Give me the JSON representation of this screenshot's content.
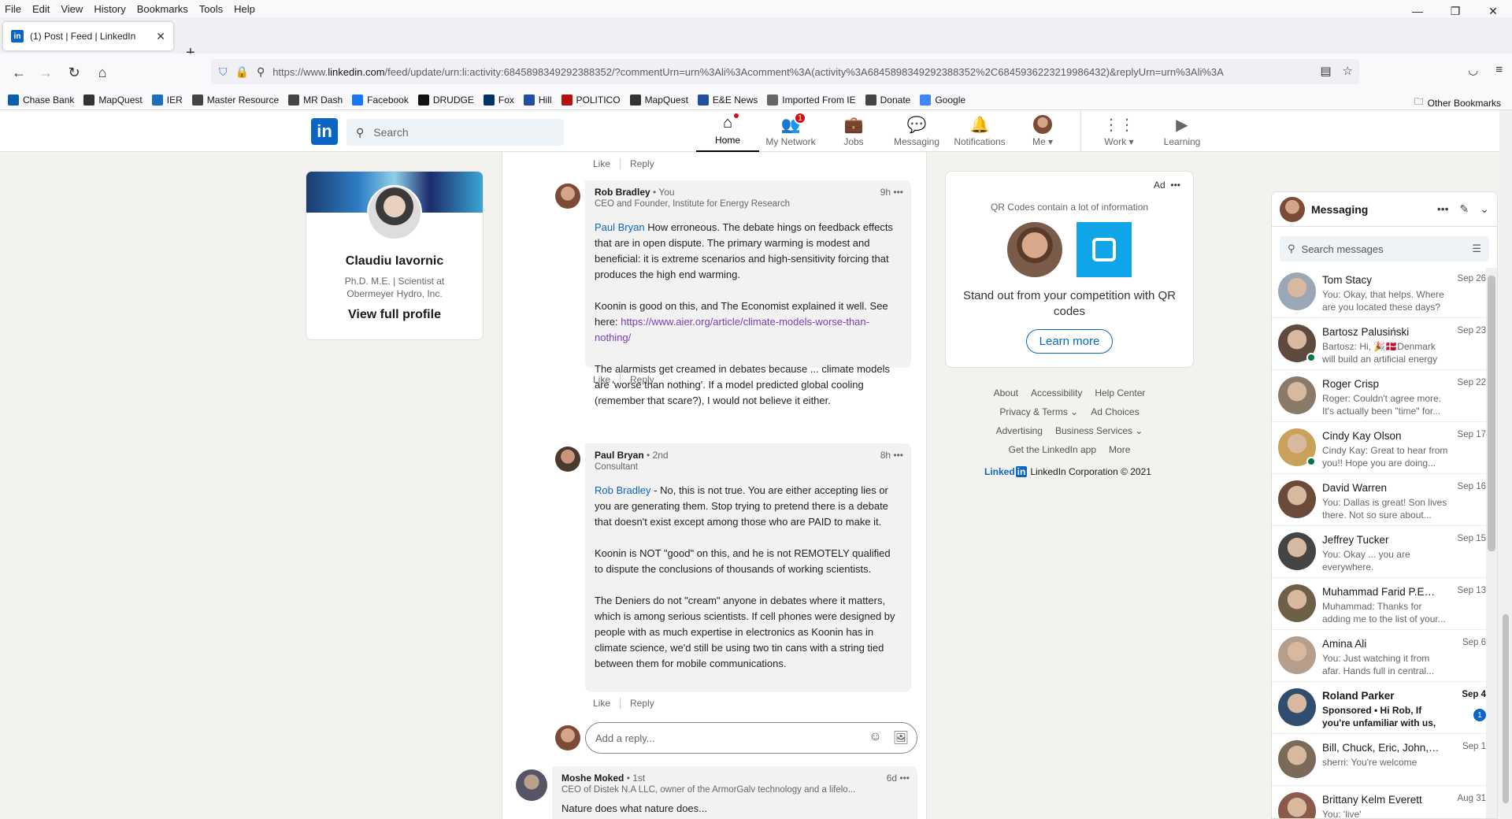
{
  "browser": {
    "menu": [
      "File",
      "Edit",
      "View",
      "History",
      "Bookmarks",
      "Tools",
      "Help"
    ],
    "tab_title": "(1) Post | Feed | LinkedIn",
    "url_prefix": "https://www.",
    "url_domain": "linkedin.com",
    "url_rest": "/feed/update/urn:li:activity:6845898349292388352/?commentUrn=urn%3Ali%3Acomment%3A(activity%3A6845898349292388352%2C6845936223219986432)&replyUrn=urn%3Ali%3A",
    "bookmarks": [
      {
        "label": "Chase Bank",
        "icon": "chase-icon",
        "color": "#0b5ea8"
      },
      {
        "label": "MapQuest",
        "icon": "mapquest-icon",
        "color": "#333"
      },
      {
        "label": "IER",
        "icon": "ier-icon",
        "color": "#1f6fbf"
      },
      {
        "label": "Master Resource",
        "icon": "mr-icon",
        "color": "#444"
      },
      {
        "label": "MR Dash",
        "icon": "mr-icon",
        "color": "#444"
      },
      {
        "label": "Facebook",
        "icon": "facebook-icon",
        "color": "#1877f2"
      },
      {
        "label": "DRUDGE",
        "icon": "drudge-icon",
        "color": "#111"
      },
      {
        "label": "Fox",
        "icon": "fox-icon",
        "color": "#003366"
      },
      {
        "label": "Hill",
        "icon": "hill-icon",
        "color": "#1f4f9e"
      },
      {
        "label": "POLITICO",
        "icon": "politico-icon",
        "color": "#b3120d"
      },
      {
        "label": "MapQuest",
        "icon": "mapquest-icon",
        "color": "#333"
      },
      {
        "label": "E&E News",
        "icon": "ee-icon",
        "color": "#1f4f9e"
      },
      {
        "label": "Imported From IE",
        "icon": "folder-icon",
        "color": "#666"
      },
      {
        "label": "Donate",
        "icon": "globe-icon",
        "color": "#444"
      },
      {
        "label": "Google",
        "icon": "google-icon",
        "color": "#4285f4"
      }
    ],
    "other_bookmarks": "Other Bookmarks"
  },
  "linkedin": {
    "search_placeholder": "Search",
    "nav": [
      {
        "label": "Home",
        "icon": "home-icon"
      },
      {
        "label": "My Network",
        "icon": "network-icon",
        "badge": "1"
      },
      {
        "label": "Jobs",
        "icon": "jobs-icon"
      },
      {
        "label": "Messaging",
        "icon": "messaging-icon"
      },
      {
        "label": "Notifications",
        "icon": "bell-icon"
      },
      {
        "label": "Me",
        "icon": "me-avatar"
      },
      {
        "label": "Work",
        "icon": "grid-icon"
      },
      {
        "label": "Learning",
        "icon": "learning-icon"
      }
    ]
  },
  "profile": {
    "name": "Claudiu Iavornic",
    "headline": "Ph.D. M.E. | Scientist at Obermeyer Hydro, Inc.",
    "view_profile": "View full profile"
  },
  "feed": {
    "like": "Like",
    "reply": "Reply",
    "comments": [
      {
        "author": "Rob Bradley",
        "degree": "• You",
        "title": "CEO and Founder, Institute for Energy Research",
        "time": "9h",
        "mention": "Paul Bryan",
        "p1": " How erroneous. The debate hings on feedback effects that are in open dispute. The primary warming is modest and beneficial: it is extreme scenarios and high-sensitivity forcing that produces the high end warming.",
        "p2_pre": "Koonin is good on this, and The Economist explained it well. See here: ",
        "p2_link": "https://www.aier.org/article/climate-models-worse-than-nothing/",
        "p3": "The alarmists get creamed in debates because ... climate models are 'worse than nothing'. If a model predicted global cooling (remember that scare?), I would not believe it either."
      },
      {
        "author": "Paul Bryan",
        "degree": "• 2nd",
        "title": "Consultant",
        "time": "8h",
        "mention": "Rob Bradley",
        "p1": " - No, this is not true. You are either accepting lies or you are generating them. Stop trying to pretend there is a debate that doesn't exist except among those who are PAID to make it.",
        "p2": "Koonin is NOT \"good\" on this, and he is not REMOTELY qualified to dispute the conclusions of thousands of working scientists.",
        "p3": "The Deniers do not \"cream\" anyone in debates where it matters, which is among serious scientists. If cell phones were designed by people with as much expertise in electronics as Koonin has in climate science, we'd still be using two tin cans with a string tied between them for mobile communications."
      },
      {
        "author": "Moshe Moked",
        "degree": "• 1st",
        "title": "CEO of Distek N.A LLC, owner of the ArmorGalv technology and a lifelo...",
        "time": "6d",
        "body": "Nature does what nature does..."
      }
    ],
    "reply_placeholder": "Add a reply..."
  },
  "ad": {
    "label": "Ad",
    "caption": "QR Codes contain a lot of information",
    "text": "Stand out from your competition with QR codes",
    "button": "Learn more"
  },
  "footer": {
    "row1": [
      "About",
      "Accessibility",
      "Help Center"
    ],
    "row2": [
      "Privacy & Terms ⌄",
      "Ad Choices"
    ],
    "row3": [
      "Advertising",
      "Business Services ⌄"
    ],
    "row4": [
      "Get the LinkedIn app",
      "More"
    ],
    "logo": "Linked",
    "logo_in": "in",
    "corp": "LinkedIn Corporation © 2021"
  },
  "messaging": {
    "title": "Messaging",
    "search_placeholder": "Search messages",
    "conversations": [
      {
        "name": "Tom Stacy",
        "date": "Sep 26",
        "preview": "You: Okay, that helps. Where are you located these days?",
        "avatar_color": "#9aa7b5",
        "online": false
      },
      {
        "name": "Bartosz Palusiński",
        "date": "Sep 23",
        "preview": "Bartosz: Hi, 🎉🇩🇰Denmark will build an artificial energy island....",
        "avatar_color": "#5f4a3f",
        "online": true
      },
      {
        "name": "Roger Crisp",
        "date": "Sep 22",
        "preview": "Roger: Couldn't agree more. It's actually been \"time\" for...",
        "avatar_color": "#8a7a6a",
        "online": false
      },
      {
        "name": "Cindy Kay Olson",
        "date": "Sep 17",
        "preview": "Cindy Kay: Great to hear from you!! Hope you are doing...",
        "avatar_color": "#c9a15b",
        "online": true
      },
      {
        "name": "David Warren",
        "date": "Sep 16",
        "preview": "You: Dallas is great!  Son lives there. Not so sure about...",
        "avatar_color": "#6b4a3a",
        "online": false
      },
      {
        "name": "Jeffrey Tucker",
        "date": "Sep 15",
        "preview": "You: Okay ... you are everywhere.",
        "avatar_color": "#444",
        "online": false
      },
      {
        "name": "Muhammad Farid P.Eng ...",
        "date": "Sep 13",
        "preview": "Muhammad: Thanks for adding me to the list of your...",
        "avatar_color": "#6e6048",
        "online": false
      },
      {
        "name": "Amina Ali",
        "date": "Sep 6",
        "preview": "You: Just watching it from afar. Hands full in central...",
        "avatar_color": "#b59e8c",
        "online": false
      },
      {
        "name": "Roland Parker",
        "date": "Sep 4",
        "preview": "Sponsored •  Hi Rob, If you're unfamiliar with us, my...",
        "avatar_color": "#2f4d6e",
        "online": false,
        "unread": "1"
      },
      {
        "name": "Bill, Chuck, Eric, John, Joh...",
        "date": "Sep 1",
        "preview": "sherri: You're welcome",
        "avatar_color": "#7a6a5a",
        "online": false
      },
      {
        "name": "Brittany Kelm Everett",
        "date": "Aug 31",
        "preview": "You: 'live'",
        "avatar_color": "#8a5a4a",
        "online": false
      }
    ]
  }
}
